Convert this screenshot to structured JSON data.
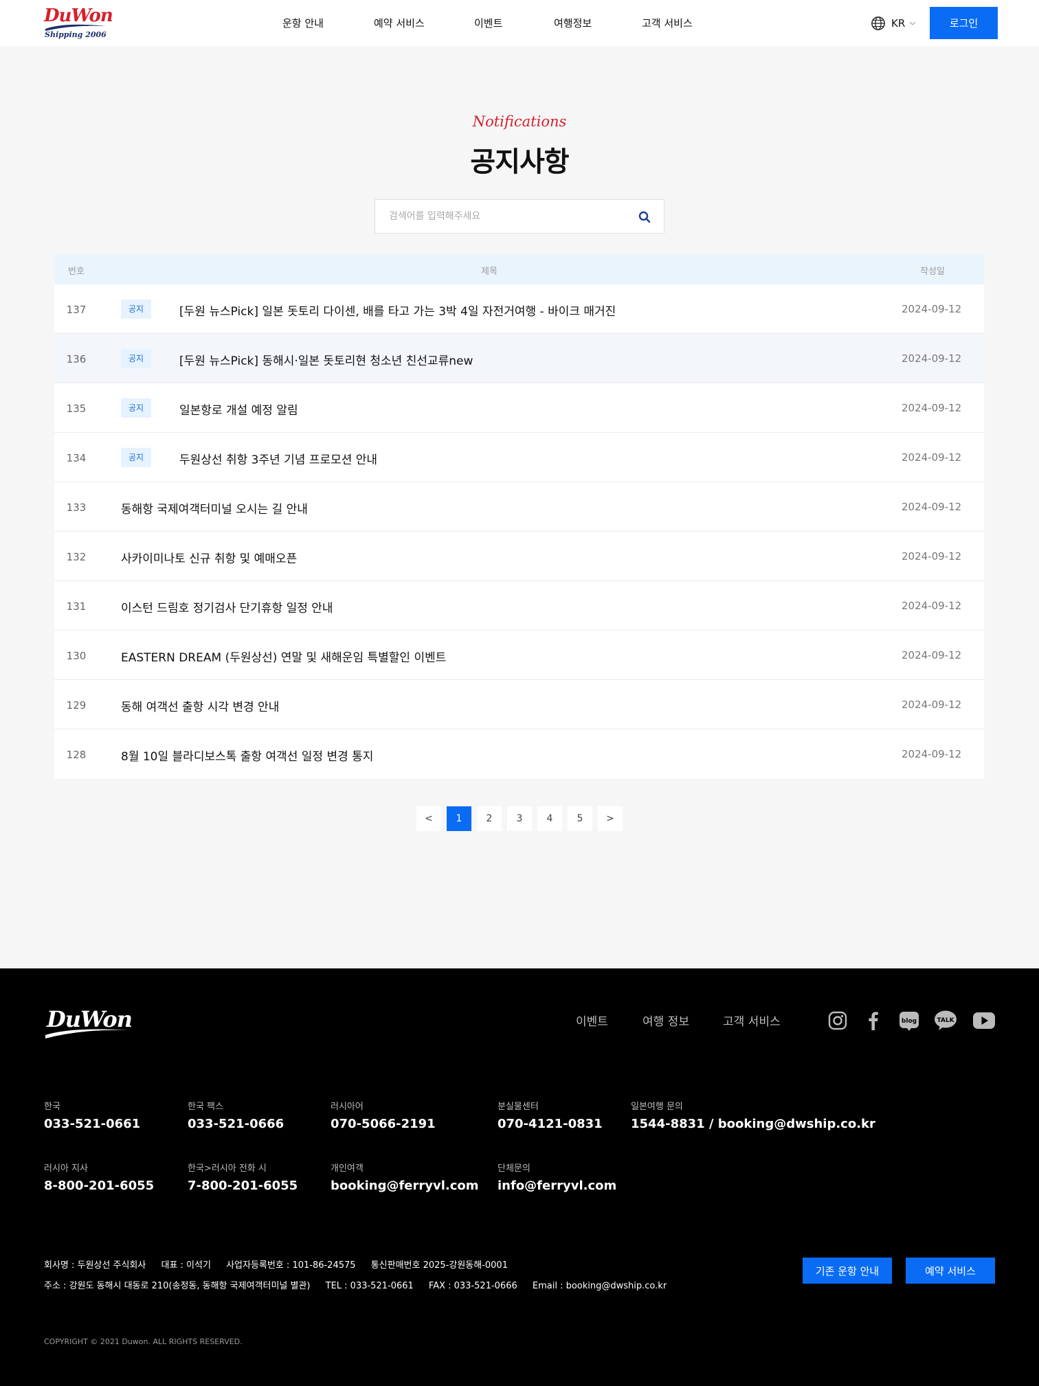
{
  "header": {
    "logo_text": "DuWon",
    "logo_sub": "Shipping 2006",
    "nav": [
      "운항 안내",
      "예약 서비스",
      "이벤트",
      "여행정보",
      "고객 서비스"
    ],
    "lang": "KR",
    "login_label": "로그인"
  },
  "main": {
    "subtitle": "Notifications",
    "title": "공지사항",
    "search_placeholder": "검색어를 입력해주세요",
    "columns": [
      "번호",
      "제목",
      "작성일"
    ],
    "badge_label": "공지",
    "rows": [
      {
        "num": "137",
        "notice": true,
        "title": "[두원 뉴스Pick] 일본 돗토리 다이센, 배를 타고 가는 3박 4일 자전거여행 - 바이크 매거진",
        "date": "2024-09-12"
      },
      {
        "num": "136",
        "notice": true,
        "title": "[두원 뉴스Pick] 동해시·일본 돗토리현 청소년 친선교류new",
        "date": "2024-09-12"
      },
      {
        "num": "135",
        "notice": true,
        "title": "일본항로 개설 예정 알림",
        "date": "2024-09-12"
      },
      {
        "num": "134",
        "notice": true,
        "title": "두원상선 취항 3주년 기념 프로모션 안내",
        "date": "2024-09-12"
      },
      {
        "num": "133",
        "notice": false,
        "title": "동해항 국제여객터미널 오시는 길 안내",
        "date": "2024-09-12"
      },
      {
        "num": "132",
        "notice": false,
        "title": "사카이미나토 신규 취항 및 예매오픈",
        "date": "2024-09-12"
      },
      {
        "num": "131",
        "notice": false,
        "title": "이스턴 드림호 정기검사 단기휴항 일정 안내",
        "date": "2024-09-12"
      },
      {
        "num": "130",
        "notice": false,
        "title": "EASTERN DREAM (두원상선) 연말 및 새해운임 특별할인 이벤트",
        "date": "2024-09-12"
      },
      {
        "num": "129",
        "notice": false,
        "title": "동해 여객선 출항 시각 변경 안내",
        "date": "2024-09-12"
      },
      {
        "num": "128",
        "notice": false,
        "title": "8월 10일 블라디보스톡 출항 여객선 일정 변경 통지",
        "date": "2024-09-12"
      }
    ],
    "pagination": {
      "prev": "<",
      "pages": [
        "1",
        "2",
        "3",
        "4",
        "5"
      ],
      "current": "1",
      "next": ">"
    }
  },
  "footer": {
    "logo_text": "DuWon",
    "nav": [
      "이벤트",
      "여행 정보",
      "고객 서비스"
    ],
    "social": [
      "instagram-icon",
      "facebook-icon",
      "blog-icon",
      "kakaotalk-icon",
      "youtube-icon"
    ],
    "social_text": {
      "blog": "blog",
      "talk": "TALK"
    },
    "contacts": [
      {
        "label": "한국",
        "value": "033-521-0661"
      },
      {
        "label": "한국 팩스",
        "value": "033-521-0666"
      },
      {
        "label": "러시아어",
        "value": "070-5066-2191"
      },
      {
        "label": "분실물센터",
        "value": "070-4121-0831"
      },
      {
        "label": "일본여행 문의",
        "value": "1544-8831 / booking@dwship.co.kr"
      },
      {
        "label": "러시아 지사",
        "value": "8-800-201-6055"
      },
      {
        "label": "한국>러시아 전화 시",
        "value": "7-800-201-6055"
      },
      {
        "label": "개인여객",
        "value": "booking@ferryvl.com"
      },
      {
        "label": "단체문의",
        "value": "info@ferryvl.com"
      }
    ],
    "info1": [
      "회사명 : 두원상선 주식회사",
      "대표 : 이석기",
      "사업자등록번호 : 101-86-24575",
      "통신판매번호 2025-강원동해-0001"
    ],
    "info2": [
      "주소 : 강원도 동해시 대동로 210(송정동, 동해항 국제여객터미널 별관)",
      "TEL : 033-521-0661",
      "FAX : 033-521-0666",
      "Email : booking@dwship.co.kr"
    ],
    "btn_schedule": "기존 운항 안내",
    "btn_booking": "예약 서비스",
    "copyright": "COPYRIGHT © 2021 Duwon. ALL RIGHTS RESERVED."
  },
  "colors": {
    "accent": "#0a6cf5",
    "brand_red": "#d6202c",
    "brand_navy": "#1c2e6b",
    "badge_bg": "#e6f2fd",
    "badge_text": "#1a6fd6",
    "footer_bg": "#000000"
  }
}
